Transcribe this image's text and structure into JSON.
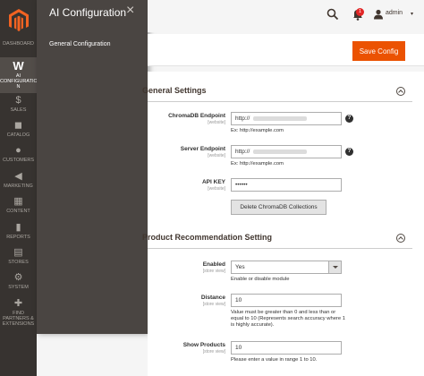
{
  "nav": {
    "items": [
      {
        "key": "dashboard",
        "label": "DASHBOARD",
        "icon": "dashboard-icon"
      },
      {
        "key": "ai",
        "label": "AI CONFIGURATIO N",
        "icon": "w-logo-icon"
      },
      {
        "key": "sales",
        "label": "SALES",
        "icon": "dollar-icon"
      },
      {
        "key": "catalog",
        "label": "CATALOG",
        "icon": "cube-icon"
      },
      {
        "key": "customers",
        "label": "CUSTOMERS",
        "icon": "person-icon"
      },
      {
        "key": "marketing",
        "label": "MARKETING",
        "icon": "megaphone-icon"
      },
      {
        "key": "content",
        "label": "CONTENT",
        "icon": "layout-icon"
      },
      {
        "key": "reports",
        "label": "REPORTS",
        "icon": "bar-chart-icon"
      },
      {
        "key": "stores",
        "label": "STORES",
        "icon": "store-icon"
      },
      {
        "key": "system",
        "label": "SYSTEM",
        "icon": "gear-icon"
      },
      {
        "key": "partners",
        "label": "FIND PARTNERS & EXTENSIONS",
        "icon": "puzzle-icon"
      }
    ]
  },
  "flyout": {
    "title": "AI Configuration",
    "close": "×",
    "link": "General Configuration"
  },
  "header": {
    "notification_count": "1",
    "user_name": "admin",
    "caret": "▾"
  },
  "actions": {
    "save_label": "Save Config"
  },
  "general": {
    "title": "General Settings",
    "endpoint_label": "ChromaDB Endpoint",
    "endpoint_scope": "[website]",
    "endpoint_value": "http://",
    "endpoint_note": "Ex: http://example.com",
    "server_label": "Server Endpoint",
    "server_scope": "[website]",
    "server_value": "http://",
    "server_note": "Ex: http://example.com",
    "apikey_label": "API KEY",
    "apikey_scope": "[website]",
    "apikey_value": "••••••",
    "delete_label": "Delete ChromaDB Collections",
    "help": "?"
  },
  "recommendation": {
    "title": "Product Recommendation Setting",
    "enabled_label": "Enabled",
    "enabled_scope": "[store view]",
    "enabled_value": "Yes",
    "enabled_note": "Enable or disable module",
    "distance_label": "Distance",
    "distance_scope": "[store view]",
    "distance_value": "10",
    "distance_note": "Value must be greater than 0 and less than or equal to 10 (Represents search accuracy where 1 is highly accurate).",
    "show_label": "Show Products",
    "show_scope": "[store view]",
    "show_value": "10",
    "show_note": "Please enter a value in range 1 to 10."
  },
  "colors": {
    "accent": "#eb5202",
    "nav_bg": "#373330",
    "flyout_bg": "#4a4542"
  }
}
